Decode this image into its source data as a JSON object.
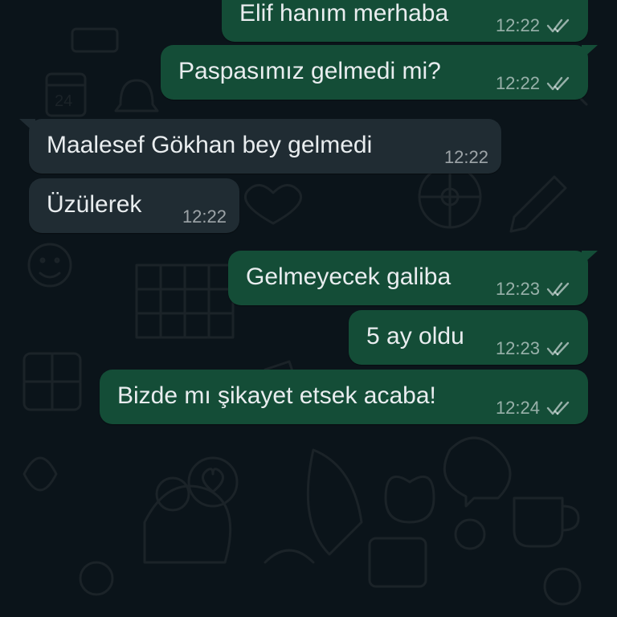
{
  "messages": [
    {
      "direction": "out",
      "text": "Elif hanım merhaba",
      "time": "12:22",
      "status": "read-double-check"
    },
    {
      "direction": "out",
      "text": "Paspasımız gelmedi mi?",
      "time": "12:22",
      "status": "read-double-check"
    },
    {
      "direction": "in",
      "text": "Maalesef Gökhan bey gelmedi",
      "time": "12:22"
    },
    {
      "direction": "in",
      "text": "Üzülerek",
      "time": "12:22"
    },
    {
      "direction": "out",
      "text": "Gelmeyecek galiba",
      "time": "12:23",
      "status": "read-double-check"
    },
    {
      "direction": "out",
      "text": "5 ay oldu",
      "time": "12:23",
      "status": "read-double-check"
    },
    {
      "direction": "out",
      "text": "Bizde mı şikayet etsek acaba!",
      "time": "12:24",
      "status": "read-double-check"
    }
  ],
  "colors": {
    "background": "#0b141a",
    "outgoing_bubble": "#144d37",
    "incoming_bubble": "#202c33",
    "text": "#e9edef",
    "meta_text": "#8696a0"
  },
  "icons": {
    "ticks": "double-check-icon",
    "wallpaper": "doodle-wallpaper"
  }
}
